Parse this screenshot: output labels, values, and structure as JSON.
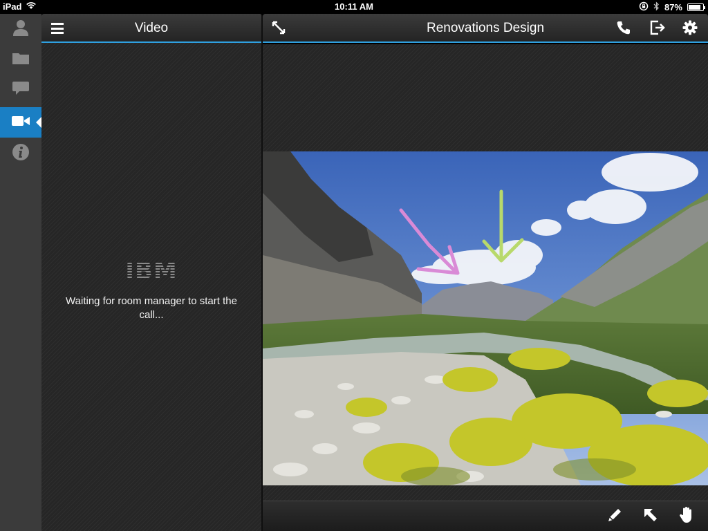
{
  "status_bar": {
    "device": "iPad",
    "time": "10:11 AM",
    "battery_percent": "87%",
    "battery_level": 0.87
  },
  "rail": {
    "items": [
      {
        "name": "profile",
        "icon": "person-icon"
      },
      {
        "name": "files",
        "icon": "folder-icon"
      },
      {
        "name": "chat",
        "icon": "chat-bubble-icon"
      },
      {
        "name": "video",
        "icon": "video-camera-icon",
        "active": true
      },
      {
        "name": "info",
        "icon": "info-icon"
      }
    ],
    "active_color": "#1a7fc4"
  },
  "video_panel": {
    "title": "Video",
    "logo_text": "IBM",
    "waiting_message": "Waiting for room manager to start the call..."
  },
  "main": {
    "title": "Renovations Design",
    "header_icons": [
      "expand-icon",
      "phone-icon",
      "exit-icon",
      "gear-icon"
    ],
    "toolbar_icons": [
      "pen-icon",
      "pointer-arrow-icon",
      "hand-icon"
    ],
    "accent_color": "#2fa0e0",
    "annotations": [
      {
        "type": "arrow",
        "color": "#d98ad6"
      },
      {
        "type": "arrow",
        "color": "#b8d96b"
      }
    ]
  }
}
